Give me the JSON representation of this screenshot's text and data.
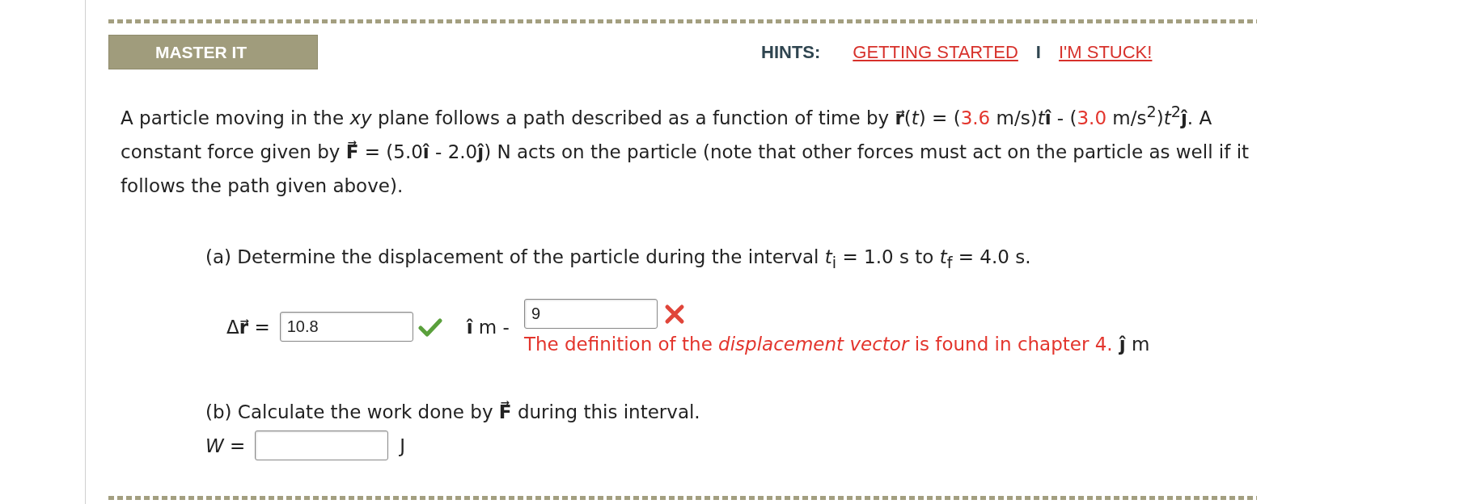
{
  "header": {
    "title": "MASTER IT",
    "hints_label": "HINTS:",
    "separator": "I",
    "hints": [
      {
        "label": "GETTING STARTED"
      },
      {
        "label": "I'M STUCK!"
      }
    ]
  },
  "problem": {
    "segments": [
      {
        "kind": "text",
        "text": "A particle moving in the *xy* plane follows a path described as a function of time by **r⃗**(*t*) = ("
      },
      {
        "kind": "given",
        "text": "3.6"
      },
      {
        "kind": "text",
        "text": " m/s)*t*"
      },
      {
        "kind": "text",
        "text": "**î** - ("
      },
      {
        "kind": "given",
        "text": "3.0"
      },
      {
        "kind": "text",
        "text": " m/s$^{2}$)*t*$^{2}$**ĵ**. A constant force given by **F⃗** = (5.0**î** - 2.0**ĵ**) N acts on the particle (note that other forces must act on the particle as well if it follows the path given above)."
      }
    ]
  },
  "part_a": {
    "prompt": "(a) Determine the displacement of the particle during the interval *t*$_{i}$ = 1.0 s to *t*$_{f}$ = 4.0 s.",
    "label": "Δ**r⃗** =",
    "components": [
      {
        "value": "10.8",
        "correct": true,
        "unit": "**î** m -"
      },
      {
        "value": "9",
        "correct": false,
        "feedback": "The definition of the *displacement vector* is found in chapter 4.",
        "unit": "**ĵ** m"
      }
    ]
  },
  "part_b": {
    "prompt": "(b) Calculate the work done by **F⃗** during this interval.",
    "label": "*W* =",
    "unit": "J"
  }
}
